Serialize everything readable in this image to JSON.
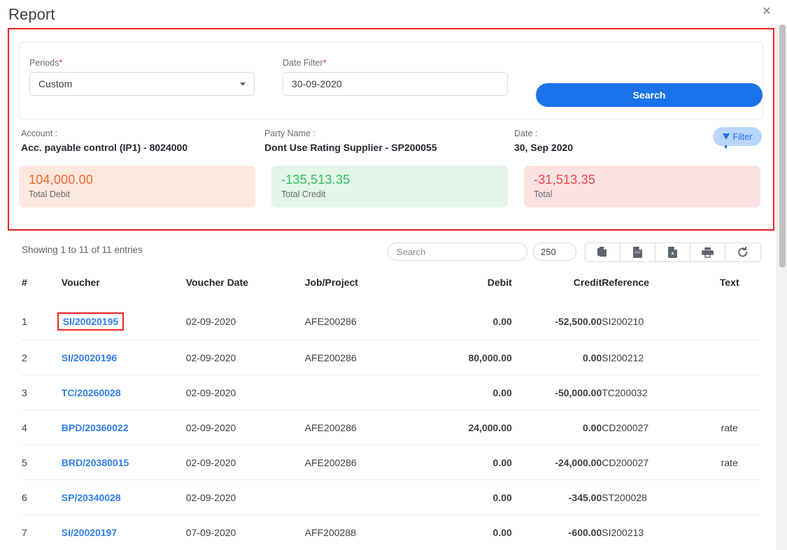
{
  "header": {
    "title": "Report",
    "close_icon": "close-icon"
  },
  "filters": {
    "periods": {
      "label": "Periods",
      "required_marker": "*",
      "value": "Custom"
    },
    "date_filter": {
      "label": "Date Filter",
      "required_marker": "*",
      "value": "30-09-2020"
    },
    "search_button": "Search"
  },
  "meta": {
    "account_label": "Account :",
    "account_value": "Acc. payable control (IP1) - 8024000",
    "party_label": "Party Name :",
    "party_value": "Dont Use Rating Supplier - SP200055",
    "date_label": "Date :",
    "date_value": "30, Sep 2020",
    "filter_button": "Filter"
  },
  "stats": [
    {
      "value": "104,000.00",
      "label": "Total Debit",
      "color": "#f4662a",
      "bg": "#fde8df"
    },
    {
      "value": "-135,513.35",
      "label": "Total Credit",
      "color": "#2fbf5e",
      "bg": "#e2f5e8"
    },
    {
      "value": "-31,513.35",
      "label": "Total",
      "color": "#f0444a",
      "bg": "#fbe2e2"
    }
  ],
  "toolbar": {
    "showing": "Showing 1 to 11 of 11 entries",
    "search_placeholder": "Search",
    "page_length": "250",
    "buttons": [
      {
        "name": "copy-icon",
        "title": "Copy"
      },
      {
        "name": "csv-file-icon",
        "title": "CSV"
      },
      {
        "name": "excel-file-icon",
        "title": "Excel"
      },
      {
        "name": "print-icon",
        "title": "Print"
      },
      {
        "name": "refresh-icon",
        "title": "Refresh"
      }
    ]
  },
  "table": {
    "columns": [
      "#",
      "Voucher",
      "Voucher Date",
      "Job/Project",
      "Debit",
      "Credit",
      "Reference",
      "Text"
    ],
    "rows": [
      {
        "idx": "1",
        "voucher": "SI/20020195",
        "date": "02-09-2020",
        "job": "AFE200286",
        "debit": "0.00",
        "credit": "-52,500.00",
        "reference": "SI200210",
        "text": "",
        "highlighted": true
      },
      {
        "idx": "2",
        "voucher": "SI/20020196",
        "date": "02-09-2020",
        "job": "AFE200286",
        "debit": "80,000.00",
        "credit": "0.00",
        "reference": "SI200212",
        "text": "",
        "highlighted": false
      },
      {
        "idx": "3",
        "voucher": "TC/20260028",
        "date": "02-09-2020",
        "job": "",
        "debit": "0.00",
        "credit": "-50,000.00",
        "reference": "TC200032",
        "text": "",
        "highlighted": false
      },
      {
        "idx": "4",
        "voucher": "BPD/20360022",
        "date": "02-09-2020",
        "job": "AFE200286",
        "debit": "24,000.00",
        "credit": "0.00",
        "reference": "CD200027",
        "text": "rate",
        "highlighted": false
      },
      {
        "idx": "5",
        "voucher": "BRD/20380015",
        "date": "02-09-2020",
        "job": "AFE200286",
        "debit": "0.00",
        "credit": "-24,000.00",
        "reference": "CD200027",
        "text": "rate",
        "highlighted": false
      },
      {
        "idx": "6",
        "voucher": "SP/20340028",
        "date": "02-09-2020",
        "job": "",
        "debit": "0.00",
        "credit": "-345.00",
        "reference": "ST200028",
        "text": "",
        "highlighted": false
      },
      {
        "idx": "7",
        "voucher": "SI/20020197",
        "date": "07-09-2020",
        "job": "AFF200288",
        "debit": "0.00",
        "credit": "-600.00",
        "reference": "SI200213",
        "text": "",
        "highlighted": false
      }
    ]
  },
  "colors": {
    "accent": "#1a73e8",
    "link": "#2f7ef0",
    "highlight_border": "#ee2222",
    "debit": "#f4662a",
    "credit": "#2fbf5e",
    "total": "#f0444a"
  }
}
